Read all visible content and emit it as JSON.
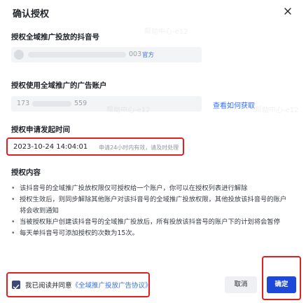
{
  "dialog": {
    "title": "确认授权",
    "close_icon": "close-icon"
  },
  "douyin": {
    "label": "授权全域推广投放的抖音号",
    "value_suffix": "003",
    "badge": "官方"
  },
  "ad_account": {
    "label": "授权使用全域推广的广告账户",
    "value_prefix": "173",
    "value_suffix": "559",
    "help_link": "查看如何获取"
  },
  "request_time": {
    "label": "授权申请发起时间",
    "value": "2023-10-24 14:04:01",
    "hint": "申请24小时内有效，请及时处理"
  },
  "content": {
    "label": "授权内容",
    "bullets": [
      "该抖音号的全域推广投放权限仅可授权给一个账户，你可以在授权列表进行解除",
      "授权生效后，则同步解除其他账户对该抖音号的全域推广投放权限，其他投放该抖音号的账户将会收到通知",
      "当被授权账户创建该抖音号的全域推广投放后，所有投放该抖音号的账户下的计划将会暂停",
      "每天单抖音号可添加授权的次数为15次。"
    ]
  },
  "footer": {
    "agree_text": "我已阅读并同意",
    "agree_link": "《全域推广投放广告协议》",
    "cancel": "取消",
    "confirm": "确定"
  },
  "watermark": "帮助中心-e12",
  "colors": {
    "accent": "#3370ff",
    "primary_button": "#1e49d8",
    "highlight_border": "#e02020"
  }
}
